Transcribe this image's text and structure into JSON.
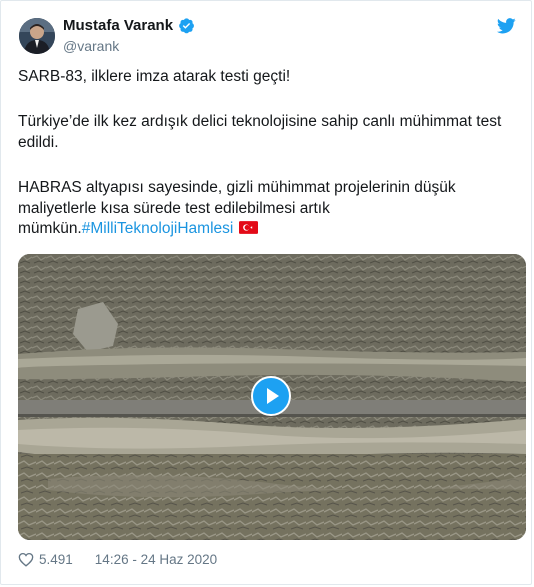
{
  "author": {
    "name": "Mustafa Varank",
    "handle": "@varank"
  },
  "tweet": {
    "line1": "SARB-83, ilklere imza atarak testi geçti!",
    "line2": "Türkiye’de ilk kez ardışık delici teknolojisine sahip canlı mühimmat test edildi.",
    "line3_text": "HABRAS altyapısı sayesinde, gizli mühimmat projelerinin düşük maliyetlerle kısa sürede test edilebilmesi artık mümkün.",
    "hashtag": "#MilliTeknolojiHamlesi"
  },
  "footer": {
    "likes": "5.491",
    "timestamp": "14:26 - 24 Haz 2020"
  },
  "icons": {
    "verified": "verified-badge-icon",
    "brand": "twitter-bird-icon",
    "flag": "turkey-flag-icon",
    "play": "play-icon",
    "like": "heart-icon"
  },
  "colors": {
    "link": "#1b95e0",
    "brand": "#1da1f2",
    "muted": "#657786"
  }
}
